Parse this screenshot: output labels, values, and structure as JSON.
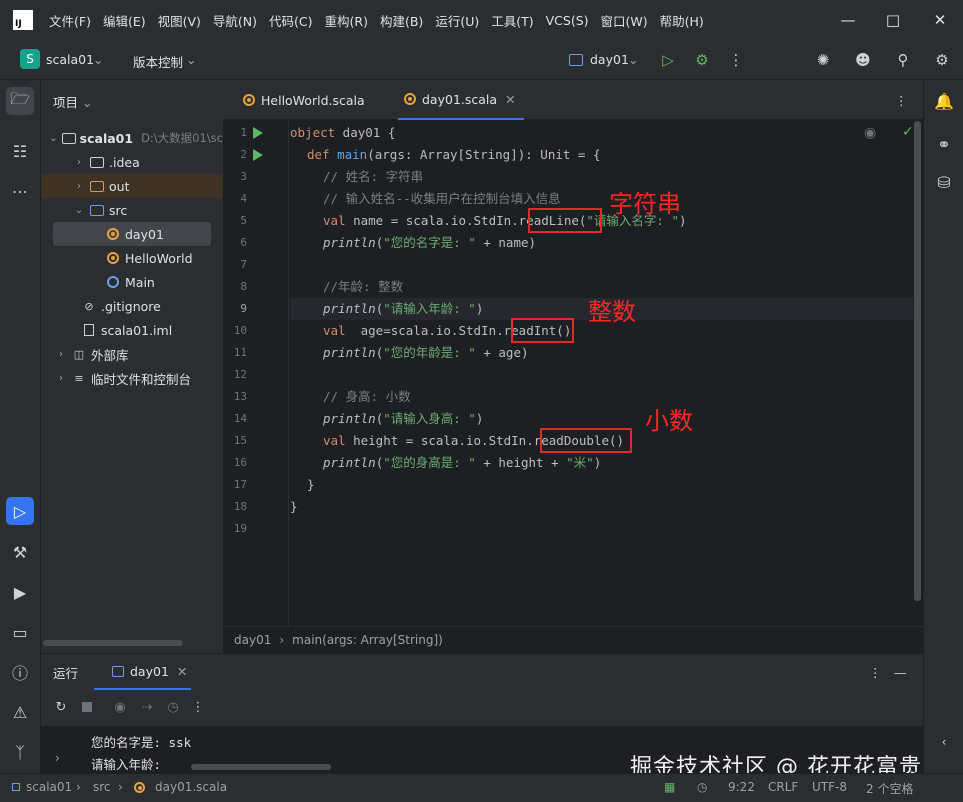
{
  "menubar": {
    "logo": "IJ",
    "items": [
      "文件(F)",
      "编辑(E)",
      "视图(V)",
      "导航(N)",
      "代码(C)",
      "重构(R)",
      "构建(B)",
      "运行(U)",
      "工具(T)",
      "VCS(S)",
      "窗口(W)",
      "帮助(H)"
    ]
  },
  "toolbar": {
    "project_badge": "S",
    "project_name": "scala01",
    "vcs_label": "版本控制",
    "run_config": "day01"
  },
  "project_panel": {
    "title": "项目",
    "tree": {
      "root_name": "scala01",
      "root_path": "D:\\大数据01\\sc",
      "idea": ".idea",
      "out": "out",
      "src": "src",
      "day01": "day01",
      "helloworld": "HelloWorld",
      "main": "Main",
      "gitignore": ".gitignore",
      "iml": "scala01.iml",
      "external_libs": "外部库",
      "scratches": "临时文件和控制台"
    }
  },
  "editor": {
    "tabs": [
      "HelloWorld.scala",
      "day01.scala"
    ],
    "line_numbers": [
      "1",
      "2",
      "3",
      "4",
      "5",
      "6",
      "7",
      "8",
      "9",
      "10",
      "11",
      "12",
      "13",
      "14",
      "15",
      "16",
      "17",
      "18",
      "19"
    ],
    "code": {
      "l1": {
        "kw": "object",
        "rest": " day01 {"
      },
      "l2": {
        "kw": "def",
        "fn": "main",
        "rest": "(args: Array[String]): Unit = {"
      },
      "l3": "// 姓名: 字符串",
      "l4": "// 输入姓名--收集用户在控制台填入信息",
      "l5": {
        "kw": "val",
        "a": " name = scala.io.StdIn.",
        "b": "readLine(",
        "s": "\"请输入名字: \"",
        "c": ")"
      },
      "l6": {
        "p": "println",
        "a": "(",
        "s": "\"您的名字是: \"",
        "b": " + name)"
      },
      "l8": "//年龄: 整数",
      "l9": {
        "p": "println",
        "a": "(",
        "s": "\"请输入年龄: \"",
        "b": ")"
      },
      "l10": {
        "kw": "val",
        "a": "  age=scala.io.StdIn.",
        "b": "readInt()"
      },
      "l11": {
        "p": "println",
        "a": "(",
        "s": "\"您的年龄是: \"",
        "b": " + age)"
      },
      "l13": "// 身高: 小数",
      "l14": {
        "p": "println",
        "a": "(",
        "s": "\"请输入身高: \"",
        "b": ")"
      },
      "l15": {
        "kw": "val",
        "a": " height = scala.io.StdIn.",
        "b": "readDouble()"
      },
      "l16": {
        "p": "println",
        "a": "(",
        "s": "\"您的身高是: \"",
        "b": " + height + ",
        "s2": "\"米\"",
        "c": ")"
      },
      "l17": "}",
      "l18": "}"
    },
    "annotations": [
      "字符串",
      "整数",
      "小数"
    ],
    "breadcrumb": [
      "day01",
      "main(args: Array[String])"
    ]
  },
  "run_panel": {
    "title": "运行",
    "tab": "day01",
    "output": [
      "您的名字是: ssk",
      "请输入年龄: "
    ]
  },
  "statusbar": {
    "path": [
      "scala01",
      "src",
      "day01.scala"
    ],
    "position": "9:22",
    "line_sep": "CRLF",
    "encoding": "UTF-8",
    "indent": "2 个空格"
  },
  "watermark": "掘金技术社区 @ 花开花富贵",
  "colors": {
    "accent": "#3574f0",
    "annotation": "#ff2525",
    "run_green": "#5fb865",
    "scala_orange": "#e8a33d"
  }
}
